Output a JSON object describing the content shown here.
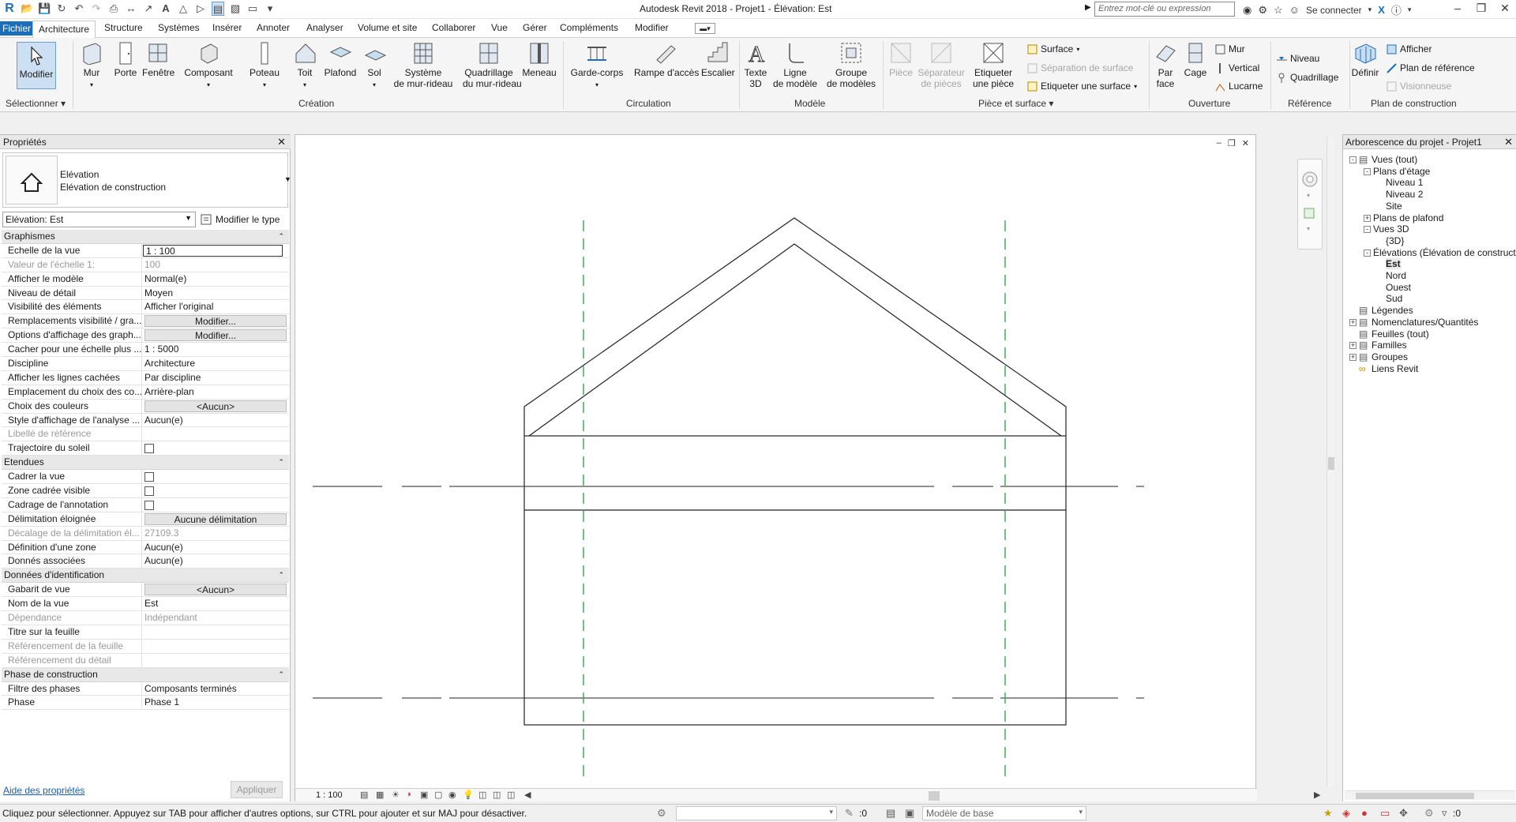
{
  "titlebar": {
    "app_title": "Autodesk Revit 2018 -     Projet1 - Élévation: Est",
    "search_placeholder": "Entrez mot-clé ou expression",
    "signin_label": "Se connecter"
  },
  "menu": {
    "tabs": [
      "Fichier",
      "Architecture",
      "Structure",
      "Systèmes",
      "Insérer",
      "Annoter",
      "Analyser",
      "Volume et site",
      "Collaborer",
      "Vue",
      "Gérer",
      "Compléments",
      "Modifier"
    ],
    "active": "Architecture"
  },
  "ribbon": {
    "select_label": "Modifier",
    "select_panel": "Sélectionner",
    "creation": {
      "panel": "Création",
      "mur": "Mur",
      "porte": "Porte",
      "fenetre": "Fenêtre",
      "composant": "Composant",
      "poteau": "Poteau",
      "toit": "Toit",
      "plafond": "Plafond",
      "sol": "Sol",
      "systeme_1": "Système",
      "systeme_2": "de mur-rideau",
      "quadrillage_1": "Quadrillage",
      "quadrillage_2": "du mur-rideau",
      "meneau": "Meneau"
    },
    "circulation": {
      "panel": "Circulation",
      "garde_corps": "Garde-corps",
      "rampe": "Rampe d'accès",
      "escalier": "Escalier"
    },
    "modele": {
      "panel": "Modèle",
      "texte_1": "Texte",
      "texte_2": "3D",
      "ligne_1": "Ligne",
      "ligne_2": "de modèle",
      "groupe_1": "Groupe",
      "groupe_2": "de modèles"
    },
    "piece": {
      "panel": "Pièce et surface",
      "piece": "Pièce",
      "separateur_1": "Séparateur",
      "separateur_2": "de pièces",
      "etiquette_1": "Etiqueter",
      "etiquette_2": "une pièce",
      "surface": "Surface",
      "separation_surface": "Séparation  de surface",
      "etiqueter_surface": "Etiqueter  une surface"
    },
    "ouverture": {
      "panel": "Ouverture",
      "par_face_1": "Par",
      "par_face_2": "face",
      "cage": "Cage",
      "mur": "Mur",
      "vertical": "Vertical",
      "lucarne": "Lucarne"
    },
    "reference": {
      "panel": "Référence",
      "niveau": "Niveau",
      "quadrillage": "Quadrillage"
    },
    "plan": {
      "panel": "Plan de construction",
      "definir": "Définir",
      "afficher": "Afficher",
      "plan_reference": "Plan de référence",
      "visionneuse": "Visionneuse"
    }
  },
  "properties": {
    "title": "Propriétés",
    "type_line1": "Elévation",
    "type_line2": "Elévation de construction",
    "instance_select": "Elévation: Est",
    "edit_type": "Modifier le type",
    "sections": [
      {
        "name": "Graphismes",
        "rows": [
          {
            "k": "Echelle de la vue",
            "v": "1 : 100",
            "style": "edit"
          },
          {
            "k": "Valeur de l'échelle    1:",
            "v": "100",
            "style": "dim"
          },
          {
            "k": "Afficher le modèle",
            "v": "Normal(e)"
          },
          {
            "k": "Niveau de détail",
            "v": "Moyen"
          },
          {
            "k": "Visibilité des éléments",
            "v": "Afficher l'original"
          },
          {
            "k": "Remplacements visibilité / gra...",
            "v": "Modifier...",
            "style": "btn"
          },
          {
            "k": "Options d'affichage des graph...",
            "v": "Modifier...",
            "style": "btn"
          },
          {
            "k": "Cacher pour une échelle plus ...",
            "v": "1 : 5000"
          },
          {
            "k": "Discipline",
            "v": "Architecture"
          },
          {
            "k": "Afficher les lignes cachées",
            "v": "Par discipline"
          },
          {
            "k": "Emplacement du choix des co...",
            "v": "Arrière-plan"
          },
          {
            "k": "Choix des couleurs",
            "v": "<Aucun>",
            "style": "btn"
          },
          {
            "k": "Style d'affichage de l'analyse ...",
            "v": "Aucun(e)"
          },
          {
            "k": "Libellé de référence",
            "v": "",
            "style": "dim"
          },
          {
            "k": "Trajectoire du soleil",
            "v": "",
            "style": "check"
          }
        ]
      },
      {
        "name": "Etendues",
        "rows": [
          {
            "k": "Cadrer la vue",
            "v": "",
            "style": "check"
          },
          {
            "k": "Zone cadrée visible",
            "v": "",
            "style": "check"
          },
          {
            "k": "Cadrage de l'annotation",
            "v": "",
            "style": "check"
          },
          {
            "k": "Délimitation éloignée",
            "v": "Aucune délimitation",
            "style": "btn"
          },
          {
            "k": "Décalage de la délimitation él...",
            "v": "27109.3",
            "style": "dim"
          },
          {
            "k": "Définition d'une zone",
            "v": "Aucun(e)"
          },
          {
            "k": "Donnés associées",
            "v": "Aucun(e)"
          }
        ]
      },
      {
        "name": "Données d'identification",
        "rows": [
          {
            "k": "Gabarit de vue",
            "v": "<Aucun>",
            "style": "btn"
          },
          {
            "k": "Nom de la vue",
            "v": "Est"
          },
          {
            "k": "Dépendance",
            "v": "Indépendant",
            "style": "dim"
          },
          {
            "k": "Titre sur la feuille",
            "v": ""
          },
          {
            "k": "Référencement de la feuille",
            "v": "",
            "style": "dim"
          },
          {
            "k": "Référencement du détail",
            "v": "",
            "style": "dim"
          }
        ]
      },
      {
        "name": "Phase de construction",
        "rows": [
          {
            "k": "Filtre des phases",
            "v": "Composants terminés"
          },
          {
            "k": "Phase",
            "v": "Phase 1"
          }
        ]
      }
    ],
    "help_link": "Aide des propriétés",
    "apply": "Appliquer"
  },
  "canvas": {
    "scale": "1 : 100"
  },
  "browser": {
    "title": "Arborescence du projet - Projet1",
    "nodes": [
      {
        "label": "Vues (tout)",
        "level": 0,
        "box": "-"
      },
      {
        "label": "Plans d'étage",
        "level": 1,
        "box": "-"
      },
      {
        "label": "Niveau 1",
        "level": 2
      },
      {
        "label": "Niveau 2",
        "level": 2
      },
      {
        "label": "Site",
        "level": 2
      },
      {
        "label": "Plans de plafond",
        "level": 1,
        "box": "+"
      },
      {
        "label": "Vues 3D",
        "level": 1,
        "box": "-"
      },
      {
        "label": "{3D}",
        "level": 2
      },
      {
        "label": "Élévations (Élévation de construction)",
        "level": 1,
        "box": "-"
      },
      {
        "label": "Est",
        "level": 2,
        "bold": true
      },
      {
        "label": "Nord",
        "level": 2
      },
      {
        "label": "Ouest",
        "level": 2
      },
      {
        "label": "Sud",
        "level": 2
      },
      {
        "label": "Légendes",
        "level": 0
      },
      {
        "label": "Nomenclatures/Quantités",
        "level": 0,
        "box": "+"
      },
      {
        "label": "Feuilles (tout)",
        "level": 0
      },
      {
        "label": "Familles",
        "level": 0,
        "box": "+"
      },
      {
        "label": "Groupes",
        "level": 0,
        "box": "+"
      },
      {
        "label": "Liens Revit",
        "level": 0
      }
    ]
  },
  "status": {
    "text": "Cliquez pour sélectionner. Appuyez sur TAB pour afficher d'autres options, sur CTRL pour ajouter et sur MAJ pour désactiver.",
    "count": ":0",
    "model": "Modèle de base",
    "filter_count": ":0"
  }
}
